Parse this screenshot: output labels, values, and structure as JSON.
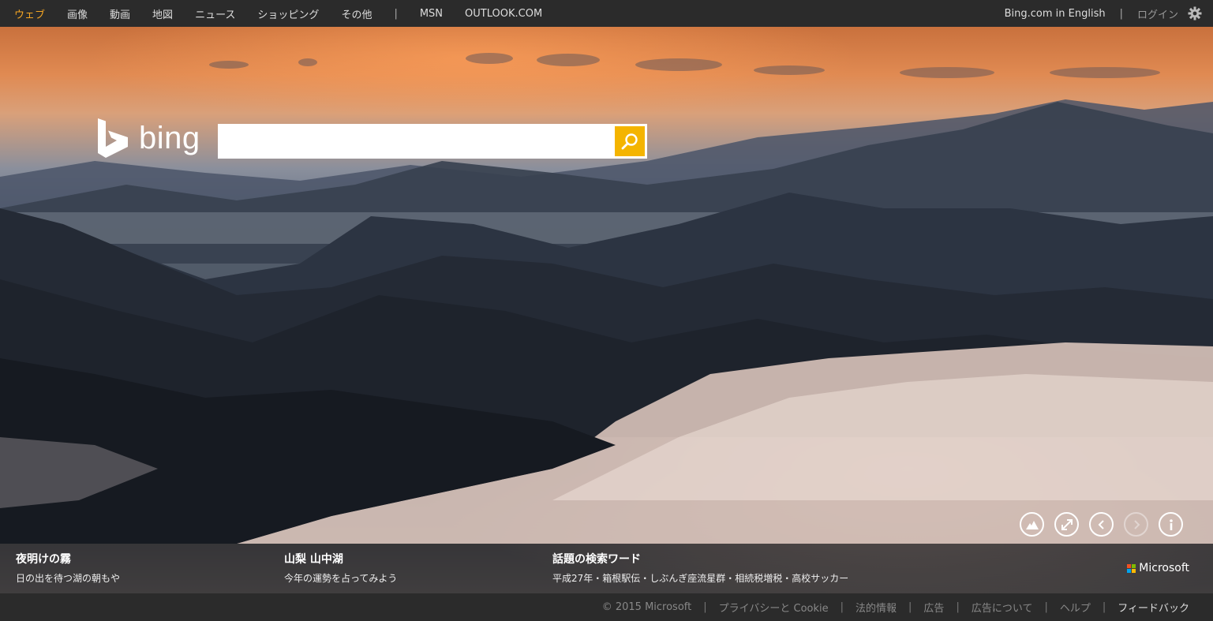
{
  "nav": {
    "items": [
      "ウェブ",
      "画像",
      "動画",
      "地図",
      "ニュース",
      "ショッピング",
      "その他"
    ],
    "separator": "|",
    "extra": [
      "MSN",
      "OUTLOOK.COM"
    ],
    "english_link": "Bing.com in English",
    "login": "ログイン",
    "active_color": "#f5a623"
  },
  "logo": {
    "text": "bing"
  },
  "search": {
    "value": "",
    "placeholder": "",
    "button_color": "#f4b400"
  },
  "captions": [
    {
      "title": "夜明けの霧",
      "subtitle": "日の出を待つ湖の朝もや"
    },
    {
      "title": "山梨 山中湖",
      "subtitle": "今年の運勢を占ってみよう"
    },
    {
      "title": "話題の検索ワード",
      "subtitle": "平成27年・箱根駅伝・しぶんぎ座流星群・相続税増税・高校サッカー"
    }
  ],
  "brand": {
    "text": "Microsoft",
    "colors": [
      "#f25022",
      "#7fba00",
      "#00a4ef",
      "#ffb900"
    ]
  },
  "controls": [
    "hiking-icon",
    "fullscreen-icon",
    "previous-icon",
    "next-icon",
    "info-icon"
  ],
  "footer": {
    "copyright": "© 2015 Microsoft",
    "links": [
      "プライバシーと Cookie",
      "法的情報",
      "広告",
      "広告について",
      "ヘルプ"
    ],
    "feedback": "フィードバック"
  }
}
